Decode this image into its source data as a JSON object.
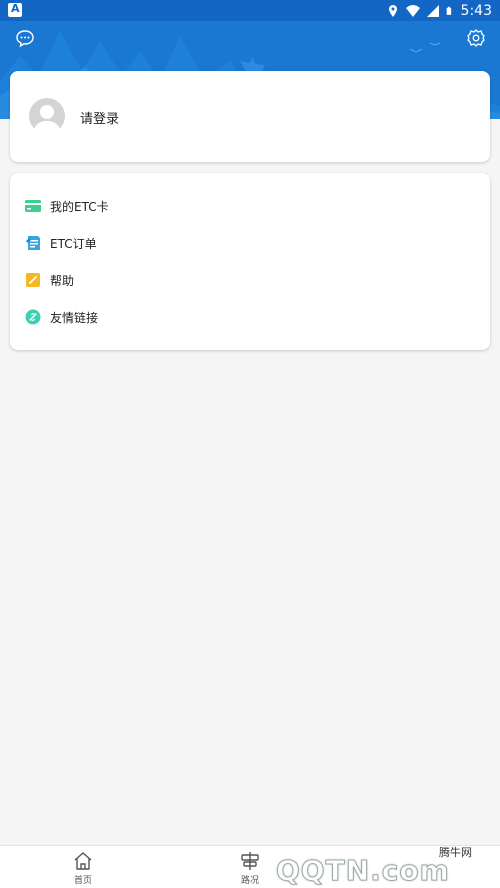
{
  "status_bar": {
    "time": "5:43",
    "indicator_letter": "A",
    "icons": [
      "location-icon",
      "wifi-icon",
      "signal-icon",
      "battery-icon"
    ]
  },
  "header": {
    "left_icon": "message-icon",
    "right_icon": "gear-icon",
    "background_color": "#1a78d2"
  },
  "profile": {
    "login_label": "请登录"
  },
  "menu": {
    "items": [
      {
        "label": "我的ETC卡",
        "icon": "card-icon",
        "color": "#3ecf8e"
      },
      {
        "label": "ETC订单",
        "icon": "order-icon",
        "color": "#35a8e0"
      },
      {
        "label": "帮助",
        "icon": "help-icon",
        "color": "#f5b820"
      },
      {
        "label": "友情链接",
        "icon": "link-icon",
        "color": "#3ecfb2"
      }
    ]
  },
  "tabbar": {
    "tabs": [
      {
        "label": "首页",
        "icon": "home-icon"
      },
      {
        "label": "路况",
        "icon": "road-sign-icon"
      }
    ]
  },
  "watermark": {
    "top_text": "腾牛网",
    "main_text": "QQTN.com"
  }
}
